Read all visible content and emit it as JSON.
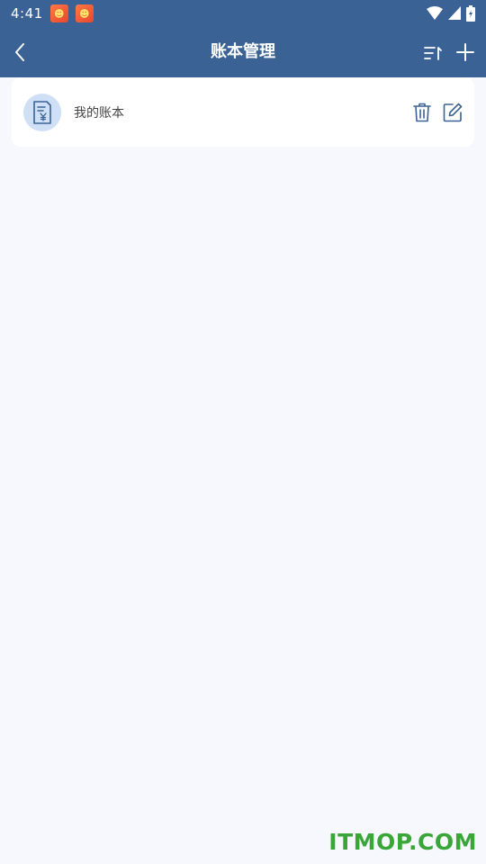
{
  "status_bar": {
    "time": "4:41",
    "notification_icons": [
      "app-notification-icon",
      "app-notification-icon"
    ],
    "system_icons": [
      "wifi-icon",
      "signal-icon",
      "battery-icon"
    ]
  },
  "app_bar": {
    "title": "账本管理",
    "back_icon": "chevron-left-icon",
    "sort_icon": "sort-icon",
    "add_icon": "plus-icon",
    "background": "#3b6294"
  },
  "books": [
    {
      "name": "我的账本",
      "icon": "ledger-yen-icon",
      "actions": [
        "trash-icon",
        "edit-icon"
      ]
    }
  ],
  "watermark": "ITMOP.COM",
  "colors": {
    "accent": "#3b6294",
    "page_bg": "#f6f8fd",
    "avatar_bg": "#cfe0f6",
    "watermark": "#3aa63a"
  }
}
